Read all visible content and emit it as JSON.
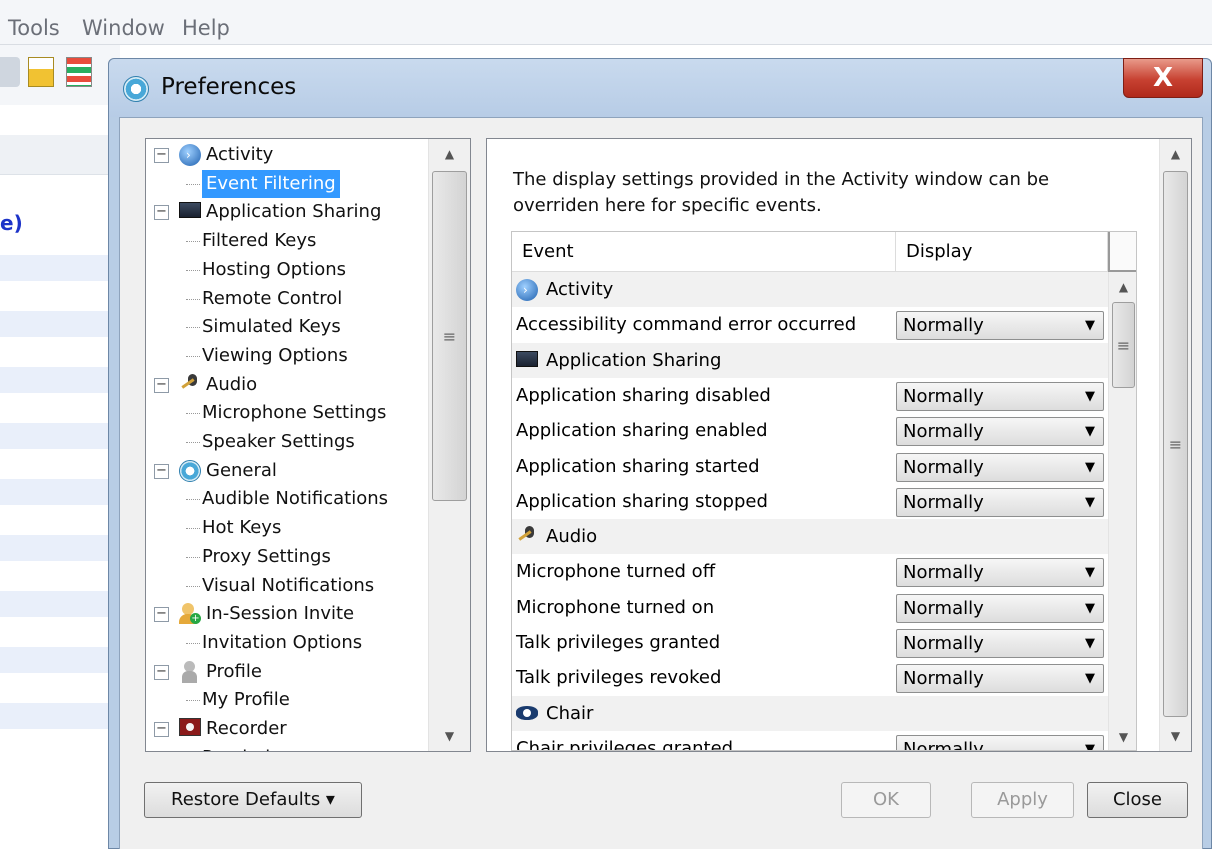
{
  "background_app": {
    "menu": [
      "Tools",
      "Window",
      "Help"
    ],
    "partial_text": "e)"
  },
  "dialog": {
    "title": "Preferences",
    "close_glyph": "X"
  },
  "tree": {
    "items": [
      {
        "label": "Activity",
        "icon": "activity-icon",
        "group": true
      },
      {
        "label": "Event Filtering",
        "selected": true
      },
      {
        "label": "Application Sharing",
        "icon": "monitor-icon",
        "group": true
      },
      {
        "label": "Filtered Keys"
      },
      {
        "label": "Hosting Options"
      },
      {
        "label": "Remote Control"
      },
      {
        "label": "Simulated Keys"
      },
      {
        "label": "Viewing Options"
      },
      {
        "label": "Audio",
        "icon": "microphone-icon",
        "group": true
      },
      {
        "label": "Microphone Settings"
      },
      {
        "label": "Speaker Settings"
      },
      {
        "label": "General",
        "icon": "general-icon",
        "group": true
      },
      {
        "label": "Audible Notifications"
      },
      {
        "label": "Hot Keys"
      },
      {
        "label": "Proxy Settings"
      },
      {
        "label": "Visual Notifications"
      },
      {
        "label": "In-Session Invite",
        "icon": "invite-icon",
        "group": true
      },
      {
        "label": "Invitation Options"
      },
      {
        "label": "Profile",
        "icon": "profile-icon",
        "group": true
      },
      {
        "label": "My Profile"
      },
      {
        "label": "Recorder",
        "icon": "recorder-icon",
        "group": true
      },
      {
        "label": "Reminder"
      }
    ]
  },
  "panel": {
    "description": "The display settings provided in the Activity window can be overriden here for specific events.",
    "columns": {
      "event": "Event",
      "display": "Display"
    },
    "rows": [
      {
        "group": true,
        "label": "Activity",
        "icon": "activity-icon"
      },
      {
        "label": "Accessibility command error occurred",
        "display": "Normally"
      },
      {
        "group": true,
        "label": "Application Sharing",
        "icon": "monitor-icon"
      },
      {
        "label": "Application sharing disabled",
        "display": "Normally"
      },
      {
        "label": "Application sharing enabled",
        "display": "Normally"
      },
      {
        "label": "Application sharing started",
        "display": "Normally"
      },
      {
        "label": "Application sharing stopped",
        "display": "Normally"
      },
      {
        "group": true,
        "label": "Audio",
        "icon": "microphone-icon"
      },
      {
        "label": "Microphone turned off",
        "display": "Normally"
      },
      {
        "label": "Microphone turned on",
        "display": "Normally"
      },
      {
        "label": "Talk privileges granted",
        "display": "Normally"
      },
      {
        "label": "Talk privileges revoked",
        "display": "Normally"
      },
      {
        "group": true,
        "label": "Chair",
        "icon": "eye-icon"
      },
      {
        "label": "Chair privileges granted",
        "display": "Normally"
      }
    ]
  },
  "buttons": {
    "restore_defaults": "Restore Defaults ▾",
    "ok": "OK",
    "apply": "Apply",
    "close": "Close"
  }
}
